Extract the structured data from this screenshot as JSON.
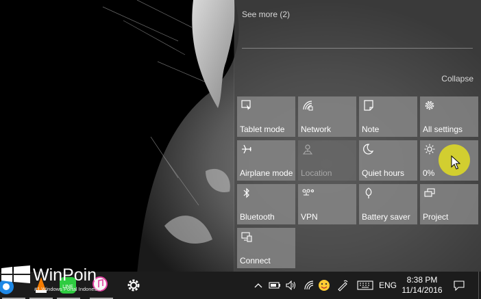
{
  "action_center": {
    "see_more": "See more (2)",
    "collapse": "Collapse",
    "tiles": [
      {
        "label": "Tablet mode",
        "icon": "tablet-mode-icon",
        "enabled": true
      },
      {
        "label": "Network",
        "icon": "network-icon",
        "enabled": true
      },
      {
        "label": "Note",
        "icon": "note-icon",
        "enabled": true
      },
      {
        "label": "All settings",
        "icon": "gear-icon",
        "enabled": true
      },
      {
        "label": "Airplane mode",
        "icon": "airplane-icon",
        "enabled": true
      },
      {
        "label": "Location",
        "icon": "location-icon",
        "enabled": false
      },
      {
        "label": "Quiet hours",
        "icon": "moon-icon",
        "enabled": true
      },
      {
        "label": "0%",
        "icon": "brightness-icon",
        "enabled": true
      },
      {
        "label": "Bluetooth",
        "icon": "bluetooth-icon",
        "enabled": true
      },
      {
        "label": "VPN",
        "icon": "vpn-icon",
        "enabled": true
      },
      {
        "label": "Battery saver",
        "icon": "battery-saver-icon",
        "enabled": true
      },
      {
        "label": "Project",
        "icon": "project-icon",
        "enabled": true
      },
      {
        "label": "Connect",
        "icon": "connect-icon",
        "enabled": true
      }
    ]
  },
  "taskbar": {
    "language": "ENG",
    "time": "8:38 PM",
    "date": "11/14/2016",
    "apps": [
      {
        "name": "browser-app-icon"
      },
      {
        "name": "vlc-app-icon"
      },
      {
        "name": "line-app-icon",
        "label": "LINE"
      },
      {
        "name": "itunes-app-icon"
      },
      {
        "name": "gear-icon"
      }
    ]
  },
  "watermark": {
    "title": "WinPoin",
    "subtitle": "#1 Windows Portal Indonesia"
  },
  "colors": {
    "cursor_highlight": "#dcd728",
    "tile_bg": "#8a8a8a",
    "taskbar_bg": "#1c1c1c"
  }
}
